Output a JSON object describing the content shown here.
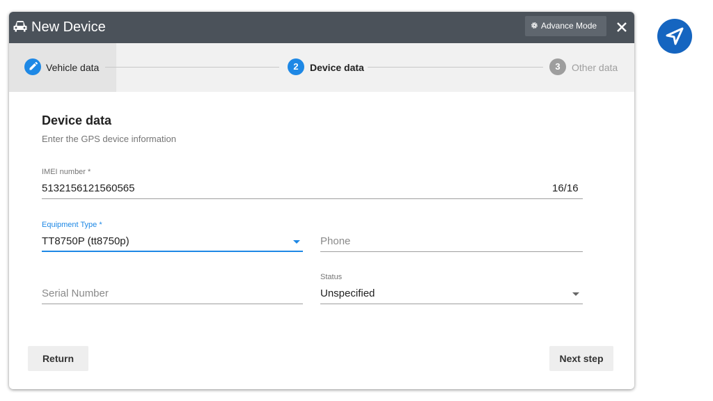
{
  "dialog": {
    "title": "New Device",
    "advance_mode_label": "Advance Mode"
  },
  "stepper": {
    "steps": [
      {
        "number": "",
        "label": "Vehicle data",
        "state": "completed"
      },
      {
        "number": "2",
        "label": "Device data",
        "state": "active"
      },
      {
        "number": "3",
        "label": "Other data",
        "state": "pending"
      }
    ]
  },
  "form": {
    "heading": "Device data",
    "subheading": "Enter the GPS device information",
    "imei": {
      "label": "IMEI number *",
      "value": "5132156121560565",
      "counter": "16/16"
    },
    "equipment_type": {
      "label": "Equipment Type *",
      "value": "TT8750P (tt8750p)"
    },
    "phone": {
      "placeholder": "Phone"
    },
    "serial_number": {
      "placeholder": "Serial Number"
    },
    "status": {
      "label": "Status",
      "value": "Unspecified"
    }
  },
  "actions": {
    "return_label": "Return",
    "next_label": "Next step"
  },
  "colors": {
    "titlebar": "#4b525a",
    "accent": "#1e88e5",
    "fab": "#1565c0"
  },
  "icons": [
    "car-icon",
    "gear-icon",
    "close-icon",
    "edit-icon",
    "dropdown-caret-icon",
    "navigation-arrow-icon"
  ]
}
